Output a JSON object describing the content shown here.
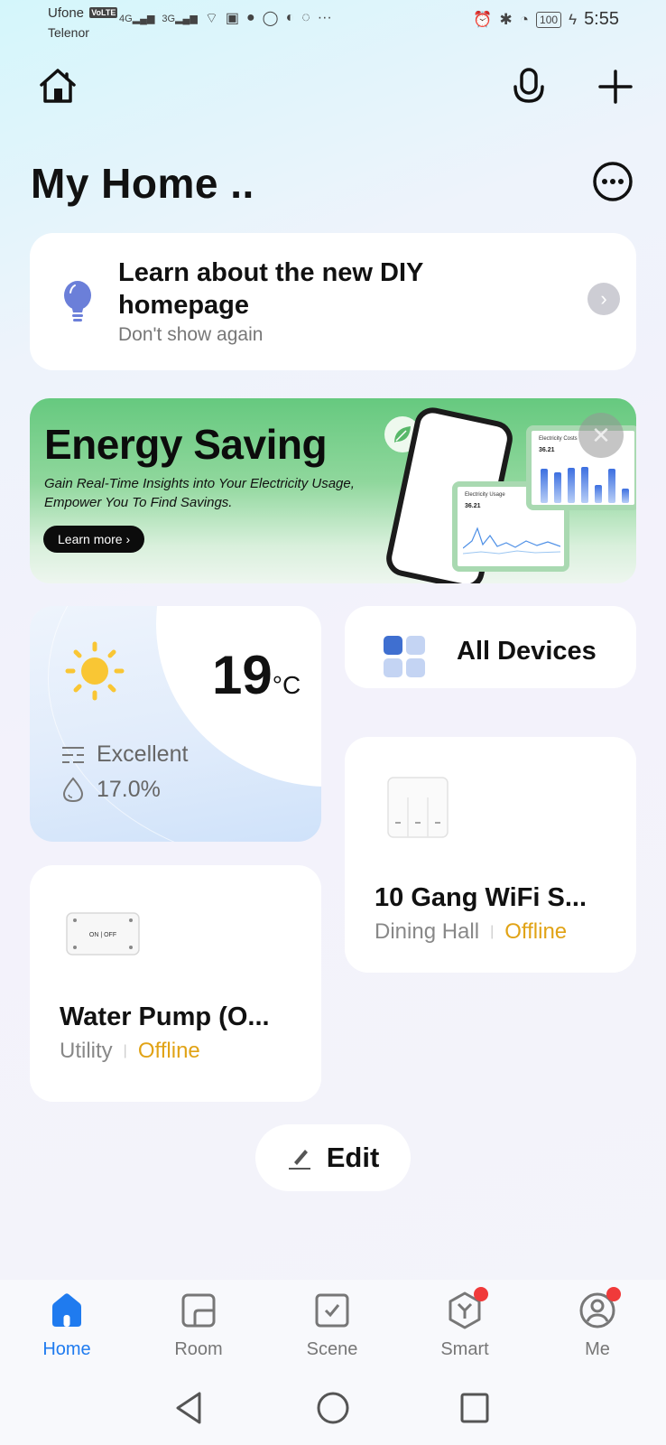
{
  "status_bar": {
    "carrier_1": "Ufone",
    "volte": "VoLTE",
    "carrier_2": "Telenor",
    "network_1": "4G",
    "network_2": "3G",
    "battery": "100",
    "time": "5:55",
    "icons": [
      "signal-icon",
      "wifi-icon",
      "notification-icon",
      "chat-icon",
      "whatsapp-icon",
      "moon-icon",
      "loading-icon",
      "overflow-icon",
      "alarm-icon",
      "bluetooth-icon",
      "speed-icon",
      "battery-icon",
      "charging-icon"
    ]
  },
  "header": {
    "title": "My Home ..",
    "icons": [
      "home-icon",
      "microphone-icon",
      "plus-icon",
      "more-icon"
    ]
  },
  "diy_card": {
    "title": "Learn about the new DIY homepage",
    "subtitle": "Don't show again"
  },
  "banner": {
    "title": "Energy Saving",
    "subtitle": "Gain Real-Time Insights into Your Electricity Usage, Empower You To Find Savings.",
    "button": "Learn more ›",
    "mini_card_1": {
      "title": "Electricity Usage",
      "value": "36.21"
    },
    "mini_card_2": {
      "title": "Electricity Costs",
      "value": "36.21"
    }
  },
  "weather": {
    "temperature": "19",
    "unit": "°C",
    "air_quality": "Excellent",
    "humidity": "17.0%"
  },
  "all_devices": {
    "label": "All Devices"
  },
  "devices": [
    {
      "name": "10 Gang WiFi S...",
      "room": "Dining Hall",
      "status": "Offline"
    },
    {
      "name": "Water Pump (O...",
      "room": "Utility",
      "status": "Offline",
      "device_label": "ON | OFF"
    }
  ],
  "edit_button": {
    "label": "Edit"
  },
  "tab_bar": {
    "tabs": [
      {
        "label": "Home",
        "active": true
      },
      {
        "label": "Room"
      },
      {
        "label": "Scene"
      },
      {
        "label": "Smart",
        "badge": true
      },
      {
        "label": "Me",
        "badge": true
      }
    ]
  },
  "colors": {
    "accent": "#1f7bef",
    "offline": "#e1a316",
    "badge": "#f03a3a",
    "banner_green": "#66c97f"
  }
}
